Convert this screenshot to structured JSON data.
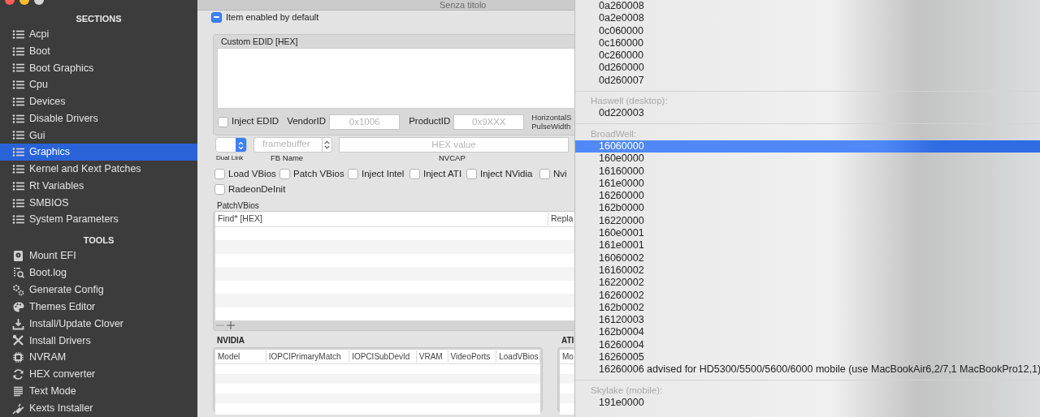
{
  "window": {
    "title": "Senza titolo"
  },
  "sidebar": {
    "sections_heading": "SECTIONS",
    "sections": [
      {
        "label": "Acpi",
        "selected": false
      },
      {
        "label": "Boot",
        "selected": false
      },
      {
        "label": "Boot Graphics",
        "selected": false
      },
      {
        "label": "Cpu",
        "selected": false
      },
      {
        "label": "Devices",
        "selected": false
      },
      {
        "label": "Disable Drivers",
        "selected": false
      },
      {
        "label": "Gui",
        "selected": false
      },
      {
        "label": "Graphics",
        "selected": true
      },
      {
        "label": "Kernel and Kext Patches",
        "selected": false
      },
      {
        "label": "Rt Variables",
        "selected": false
      },
      {
        "label": "SMBIOS",
        "selected": false
      },
      {
        "label": "System Parameters",
        "selected": false
      }
    ],
    "tools_heading": "TOOLS",
    "tools": [
      {
        "label": "Mount EFI"
      },
      {
        "label": "Boot.log"
      },
      {
        "label": "Generate Config"
      },
      {
        "label": "Themes Editor"
      },
      {
        "label": "Install/Update Clover"
      },
      {
        "label": "Install Drivers"
      },
      {
        "label": "NVRAM"
      },
      {
        "label": "HEX converter"
      },
      {
        "label": "Text Mode"
      },
      {
        "label": "Kexts Installer"
      }
    ]
  },
  "graphics": {
    "enabled_default": {
      "label": "Item enabled by default",
      "mixed": true
    },
    "custom_edid": {
      "title": "Custom EDID [HEX]",
      "inject": {
        "label": "Inject EDID",
        "checked": false
      },
      "vendor_label": "VendorID",
      "vendor_placeholder": "0x1006",
      "product_label": "ProductID",
      "product_placeholder": "0x9XXX",
      "cut_label_lines": [
        "HorizontalS",
        "PulseWidth"
      ]
    },
    "dual_link_label": "Dual Link",
    "fb_placeholder": "framebuffer",
    "fb_label": "FB Name",
    "nvcap_placeholder": "HEX value",
    "nvcap_label": "NVCAP",
    "options": [
      {
        "label": "Load VBios",
        "checked": false
      },
      {
        "label": "Patch VBios",
        "checked": false
      },
      {
        "label": "Inject Intel",
        "checked": false
      },
      {
        "label": "Inject ATI",
        "checked": false
      },
      {
        "label": "Inject NVidia",
        "checked": false
      },
      {
        "label": "Nvi",
        "checked": false
      },
      {
        "label": "RadeonDeInit",
        "checked": false
      }
    ],
    "patch_vbios": {
      "title": "PatchVBios",
      "columns": [
        "Find* [HEX]",
        "Repla"
      ]
    },
    "nvidia": {
      "title": "NVIDIA",
      "columns": [
        "Model",
        "IOPCIPrimaryMatch",
        "IOPCISubDevId",
        "VRAM",
        "VideoPorts",
        "LoadVBios"
      ]
    },
    "ati": {
      "title": "ATI",
      "columns": [
        "Mo"
      ]
    }
  },
  "popup_menu": {
    "groups": [
      {
        "items": [
          {
            "label": "0a260008",
            "selected": false
          },
          {
            "label": "0a2e0008",
            "selected": false
          },
          {
            "label": "0c060000",
            "selected": false
          },
          {
            "label": "0c160000",
            "selected": false
          },
          {
            "label": "0c260000",
            "selected": false
          },
          {
            "label": "0d260000",
            "selected": false
          },
          {
            "label": "0d260007",
            "selected": false
          }
        ]
      },
      {
        "header": "Haswell (desktop):",
        "items": [
          {
            "label": "0d220003",
            "selected": false
          }
        ]
      },
      {
        "header": "BroadWell:",
        "items": [
          {
            "label": "16060000",
            "selected": true
          },
          {
            "label": "160e0000",
            "selected": false
          },
          {
            "label": "16160000",
            "selected": false
          },
          {
            "label": "161e0000",
            "selected": false
          },
          {
            "label": "16260000",
            "selected": false
          },
          {
            "label": "162b0000",
            "selected": false
          },
          {
            "label": "16220000",
            "selected": false
          },
          {
            "label": "160e0001",
            "selected": false
          },
          {
            "label": "161e0001",
            "selected": false
          },
          {
            "label": "16060002",
            "selected": false
          },
          {
            "label": "16160002",
            "selected": false
          },
          {
            "label": "16220002",
            "selected": false
          },
          {
            "label": "16260002",
            "selected": false
          },
          {
            "label": "162b0002",
            "selected": false
          },
          {
            "label": "16120003",
            "selected": false
          },
          {
            "label": "162b0004",
            "selected": false
          },
          {
            "label": "16260004",
            "selected": false
          },
          {
            "label": "16260005",
            "selected": false
          },
          {
            "label": "16260006 advised for HD5300/5500/5600/6000 mobile (use MacBookAir6,2/7,1 MacBookPro12,1)",
            "selected": false
          }
        ]
      },
      {
        "header": "Skylake (mobile):",
        "items": [
          {
            "label": "191e0000",
            "selected": false
          }
        ]
      }
    ]
  }
}
